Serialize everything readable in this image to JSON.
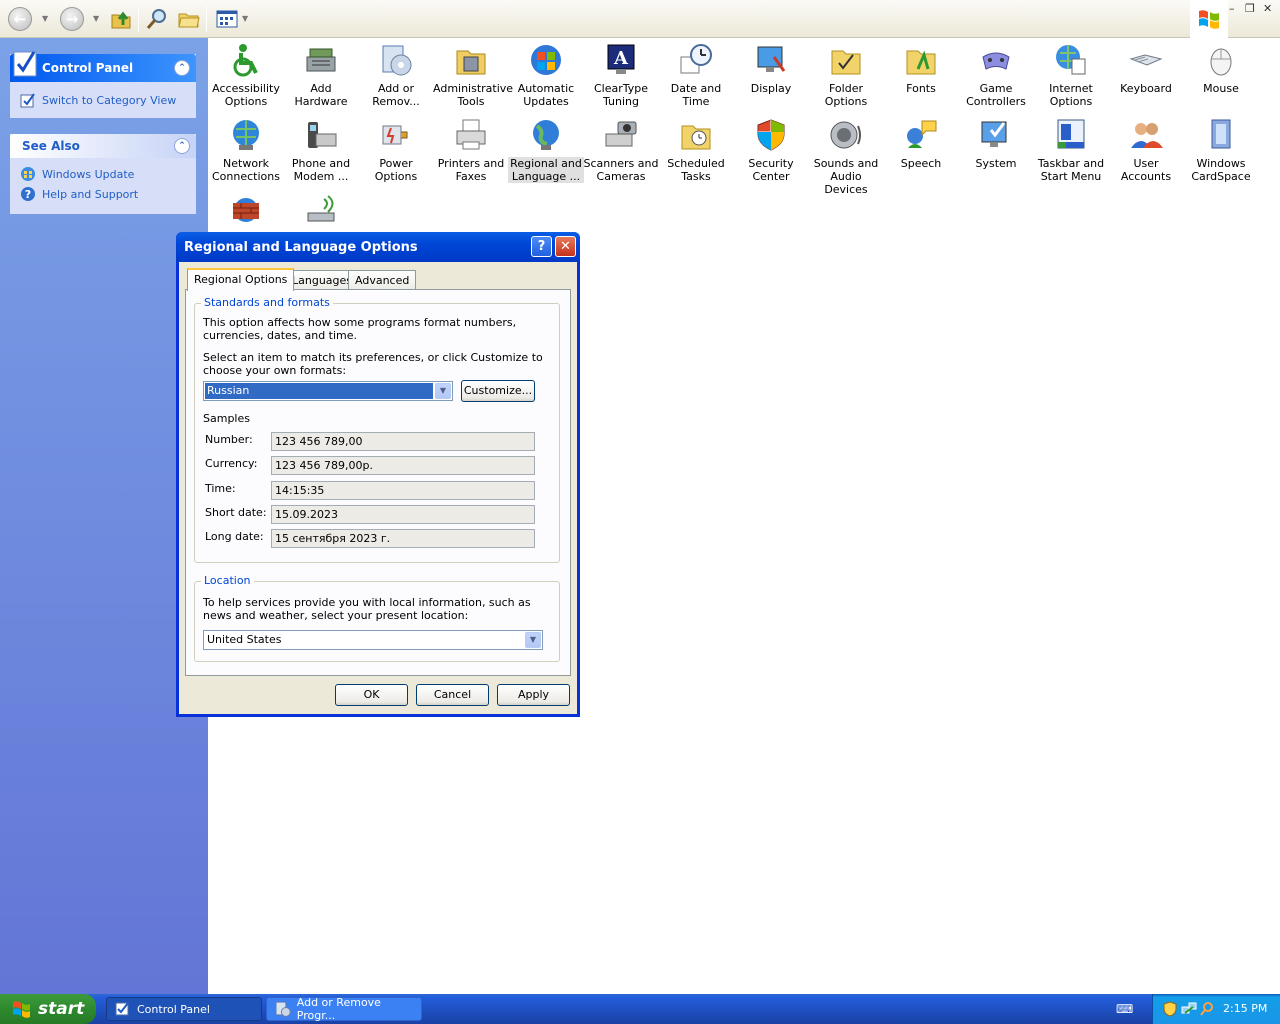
{
  "taskpane": {
    "control_panel": {
      "title": "Control Panel",
      "link": "Switch to Category View"
    },
    "see_also": {
      "title": "See Also",
      "links": [
        "Windows Update",
        "Help and Support"
      ]
    }
  },
  "icons": [
    {
      "label": "Accessibility\nOptions"
    },
    {
      "label": "Add Hardware"
    },
    {
      "label": "Add or\nRemov..."
    },
    {
      "label": "Administrative\nTools"
    },
    {
      "label": "Automatic\nUpdates"
    },
    {
      "label": "ClearType\nTuning"
    },
    {
      "label": "Date and Time"
    },
    {
      "label": "Display"
    },
    {
      "label": "Folder Options"
    },
    {
      "label": "Fonts"
    },
    {
      "label": "Game\nControllers"
    },
    {
      "label": "Internet\nOptions"
    },
    {
      "label": "Keyboard"
    },
    {
      "label": "Mouse"
    },
    {
      "label": "Network\nConnections"
    },
    {
      "label": "Phone and\nModem ..."
    },
    {
      "label": "Power Options"
    },
    {
      "label": "Printers and\nFaxes"
    },
    {
      "label": "Regional and\nLanguage ..."
    },
    {
      "label": "Scanners and\nCameras"
    },
    {
      "label": "Scheduled\nTasks"
    },
    {
      "label": "Security\nCenter"
    },
    {
      "label": "Sounds and\nAudio Devices"
    },
    {
      "label": "Speech"
    },
    {
      "label": "System"
    },
    {
      "label": "Taskbar and\nStart Menu"
    },
    {
      "label": "User Accounts"
    },
    {
      "label": "Windows\nCardSpace"
    }
  ],
  "dialog": {
    "title": "Regional and Language Options",
    "help_glyph": "?",
    "close_glyph": "✕",
    "tabs": [
      "Regional Options",
      "Languages",
      "Advanced"
    ],
    "standards": {
      "legend": "Standards and formats",
      "text1": "This option affects how some programs format numbers, currencies, dates, and time.",
      "text2": "Select an item to match its preferences, or click Customize to choose your own formats:",
      "selected_format": "Russian",
      "customize_label": "Customize...",
      "samples_heading": "Samples",
      "samples": [
        {
          "label": "Number:",
          "value": "123 456 789,00"
        },
        {
          "label": "Currency:",
          "value": "123 456 789,00р."
        },
        {
          "label": "Time:",
          "value": "14:15:35"
        },
        {
          "label": "Short date:",
          "value": "15.09.2023"
        },
        {
          "label": "Long date:",
          "value": "15 сентября 2023 г."
        }
      ]
    },
    "location": {
      "legend": "Location",
      "text": "To help services provide you with local information, such as news and weather, select your present location:",
      "value": "United States"
    },
    "buttons": {
      "ok": "OK",
      "cancel": "Cancel",
      "apply": "Apply"
    }
  },
  "taskbar": {
    "start_label": "start",
    "tasks": [
      "Control Panel",
      "Add or Remove Progr..."
    ],
    "clock": "2:15 PM"
  }
}
